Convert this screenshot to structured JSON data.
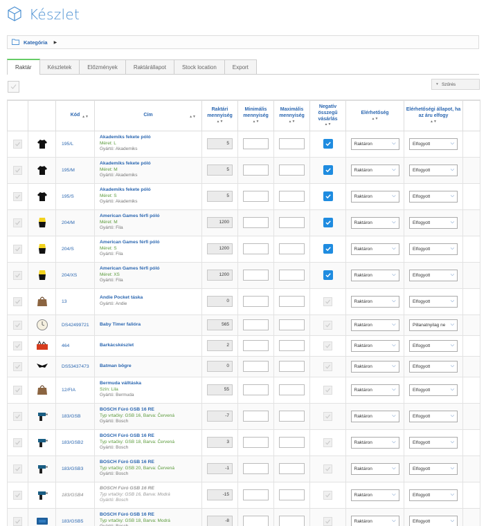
{
  "page_title": "Készlet",
  "breadcrumb": {
    "label": "Kategória"
  },
  "tabs": [
    {
      "label": "Raktár",
      "active": true
    },
    {
      "label": "Készletek"
    },
    {
      "label": "Előzmények"
    },
    {
      "label": "Raktárállapot"
    },
    {
      "label": "Stock location"
    },
    {
      "label": "Export"
    }
  ],
  "filter_label": "Szűrés",
  "columns": {
    "code": "Kód",
    "title": "Cím",
    "stock_qty": "Raktári mennyiség",
    "min_qty": "Minimális mennyiség",
    "max_qty": "Maximális mennyiség",
    "negative": "Negatív összegű vásárlás",
    "availability": "Elérhetőség",
    "oos_availability": "Elérhetőségi állapot, ha az áru elfogy"
  },
  "colors": {
    "accent": "#2a66b0",
    "checkbox": "#1f8ce0",
    "variant": "#5a9a3a"
  },
  "rows": [
    {
      "thumb": "tshirt-icon",
      "code": "195/L",
      "name": "Akademiks fekete póló",
      "variant": "Méret: L",
      "mfr": "Gyártó: Akademiks",
      "qty": "5",
      "neg": true,
      "avail": "Raktáron",
      "oos": "Elfogyott"
    },
    {
      "thumb": "tshirt-icon",
      "code": "195/M",
      "name": "Akademiks fekete póló",
      "variant": "Méret: M",
      "mfr": "Gyártó: Akademiks",
      "qty": "5",
      "neg": true,
      "avail": "Raktáron",
      "oos": "Elfogyott"
    },
    {
      "thumb": "tshirt-icon",
      "code": "195/S",
      "name": "Akademiks fekete póló",
      "variant": "Méret: S",
      "mfr": "Gyártó: Akademiks",
      "qty": "5",
      "neg": true,
      "avail": "Raktáron",
      "oos": "Elfogyott"
    },
    {
      "thumb": "yellow-shirt-icon",
      "code": "204/M",
      "name": "American Games férfi póló",
      "variant": "Méret: M",
      "mfr": "Gyártó: Fila",
      "qty": "1200",
      "neg": true,
      "avail": "Raktáron",
      "oos": "Elfogyott"
    },
    {
      "thumb": "yellow-shirt-icon",
      "code": "204/S",
      "name": "American Games férfi póló",
      "variant": "Méret: S",
      "mfr": "Gyártó: Fila",
      "qty": "1200",
      "neg": true,
      "avail": "Raktáron",
      "oos": "Elfogyott"
    },
    {
      "thumb": "yellow-shirt-icon",
      "code": "204/XS",
      "name": "American Games férfi póló",
      "variant": "Méret: XS",
      "mfr": "Gyártó: Fila",
      "qty": "1200",
      "neg": true,
      "avail": "Raktáron",
      "oos": "Elfogyott"
    },
    {
      "thumb": "bag-icon",
      "code": "13",
      "name": "Andie Pocket táska",
      "variant": "",
      "mfr": "Gyártó: Andie",
      "qty": "0",
      "neg": false,
      "avail": "Raktáron",
      "oos": "Elfogyott"
    },
    {
      "thumb": "clock-icon",
      "code": "DS42499721",
      "name": "Baby Timer falióra",
      "variant": "",
      "mfr": "",
      "qty": "565",
      "neg": false,
      "avail": "Raktáron",
      "oos": "Pillanatnyilag ne"
    },
    {
      "thumb": "toolbox-icon",
      "code": "464",
      "name": "Barkácskészlet",
      "variant": "",
      "mfr": "",
      "qty": "2",
      "neg": false,
      "avail": "Raktáron",
      "oos": "Elfogyott"
    },
    {
      "thumb": "mug-icon",
      "code": "DS53437473",
      "name": "Batman bögre",
      "variant": "",
      "mfr": "",
      "qty": "0",
      "neg": false,
      "avail": "Raktáron",
      "oos": "Elfogyott"
    },
    {
      "thumb": "bag-icon",
      "code": "12/FIA",
      "name": "Bermuda válltáska",
      "variant": "Szín: Lila",
      "mfr": "Gyártó: Bermuda",
      "qty": "55",
      "neg": false,
      "avail": "Raktáron",
      "oos": "Elfogyott"
    },
    {
      "thumb": "drill-icon",
      "code": "183/GSB",
      "name": "BOSCH Fúró GSB 16 RE",
      "variant": "Typ vrtačky: GSB 16, Barva: Červená",
      "mfr": "Gyártó: Bosch",
      "qty": "-7",
      "neg": false,
      "avail": "Raktáron",
      "oos": "Elfogyott"
    },
    {
      "thumb": "drill-icon",
      "code": "183/GSB2",
      "name": "BOSCH Fúró GSB 16 RE",
      "variant": "Typ vrtačky: GSB 18, Barva: Červená",
      "mfr": "Gyártó: Bosch",
      "qty": "3",
      "neg": false,
      "avail": "Raktáron",
      "oos": "Elfogyott"
    },
    {
      "thumb": "drill-icon",
      "code": "183/GSB3",
      "name": "BOSCH Fúró GSB 16 RE",
      "variant": "Typ vrtačky: GSB 20, Barva: Červená",
      "mfr": "Gyártó: Bosch",
      "qty": "-1",
      "neg": false,
      "avail": "Raktáron",
      "oos": "Elfogyott"
    },
    {
      "thumb": "drill-icon",
      "code": "183/GSB4",
      "name": "BOSCH Fúró GSB 16 RE",
      "variant": "Typ vrtačky: GSB 16, Barva: Modrá",
      "mfr": "Gyártó: Bosch",
      "qty": "-15",
      "neg": false,
      "avail": "Raktáron",
      "oos": "Elfogyott",
      "dim": true
    },
    {
      "thumb": "drill-case-icon",
      "code": "183/GSB5",
      "name": "BOSCH Fúró GSB 16 RE",
      "variant": "Typ vrtačky: GSB 18, Barva: Modrá",
      "mfr": "Gyártó: Bosch",
      "qty": "-8",
      "neg": false,
      "avail": "Raktáron",
      "oos": "Elfogyott"
    }
  ]
}
